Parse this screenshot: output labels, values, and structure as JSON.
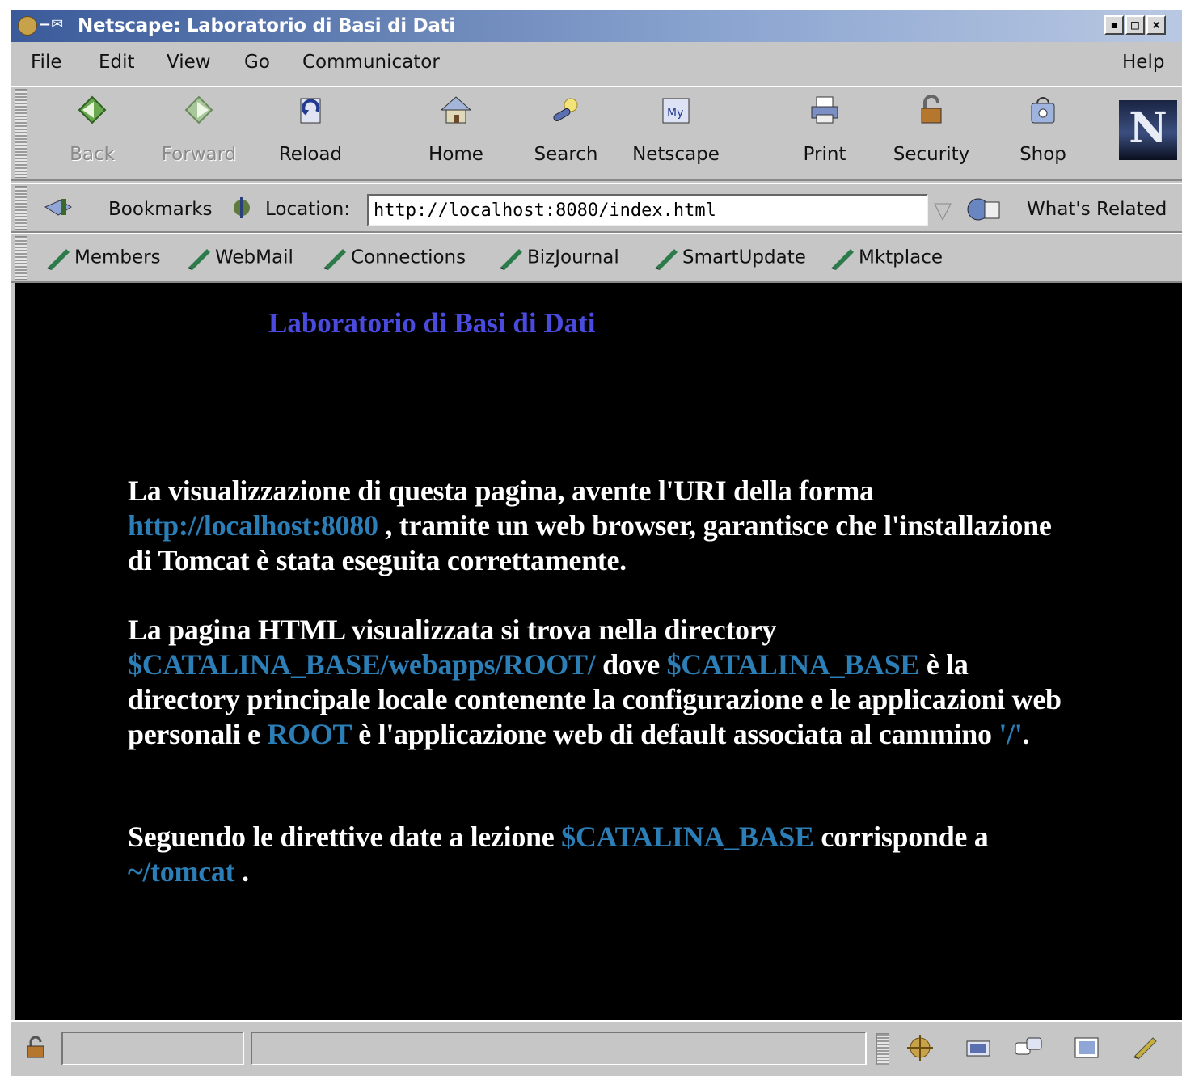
{
  "window": {
    "title": "Netscape: Laboratorio di Basi di Dati",
    "title_prefix": "−✉"
  },
  "menu": {
    "file": "File",
    "edit": "Edit",
    "view": "View",
    "go": "Go",
    "communicator": "Communicator",
    "help": "Help"
  },
  "navbar": {
    "back": "Back",
    "forward": "Forward",
    "reload": "Reload",
    "home": "Home",
    "search": "Search",
    "netscape": "Netscape",
    "print": "Print",
    "security": "Security",
    "shop": "Shop",
    "logo": "N"
  },
  "location": {
    "bookmarks": "Bookmarks",
    "label": "Location:",
    "url": "http://localhost:8080/index.html",
    "whats_related": "What's Related"
  },
  "personal": [
    "Members",
    "WebMail",
    "Connections",
    "BizJournal",
    "SmartUpdate",
    "Mktplace"
  ],
  "page": {
    "heading": "Laboratorio di Basi di Dati",
    "p1_a": "La visualizzazione di questa pagina, avente l'URI della forma ",
    "p1_link": "http://localhost:8080",
    "p1_b": " , tramite un web browser, garantisce che l'installazione di Tomcat è stata eseguita correttamente.",
    "p2_a": "La pagina HTML visualizzata si trova nella directory ",
    "p2_link1": "$CATALINA_BASE/webapps/ROOT/",
    "p2_b": " dove ",
    "p2_link2": "$CATALINA_BASE",
    "p2_c": " è la directory principale locale contenente la configurazione e le applicazioni web personali e ",
    "p2_link3": "ROOT",
    "p2_d": " è l'applicazione web di default associata al cammino ",
    "p2_link4": "'/'",
    "p2_e": ".",
    "p3_a": "Seguendo le direttive date a lezione ",
    "p3_link1": "$CATALINA_BASE",
    "p3_b": " corrisponde a ",
    "p3_link2": "~/tomcat",
    "p3_c": " ."
  },
  "colors": {
    "content_bg": "#000000",
    "heading": "#4a4adf",
    "link": "#2c7fb6",
    "text": "#ffffff"
  }
}
